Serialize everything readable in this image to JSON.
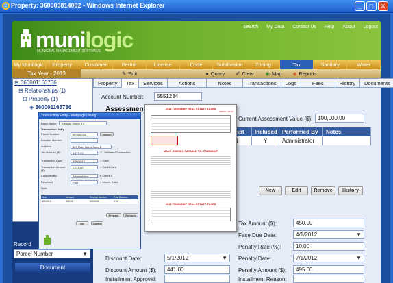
{
  "window": {
    "title": "Property: 360003814002 - Windows Internet Explorer"
  },
  "header": {
    "logo_main": "muni",
    "logo_accent": "logic",
    "logo_sub": "MUNICIPAL MANAGEMENT SOFTWARE",
    "links": [
      "Search",
      "My Data",
      "Contact Us",
      "Help",
      "About",
      "Logout"
    ]
  },
  "nav": [
    "My Munilogic",
    "Property",
    "Customer",
    "Permit",
    "License",
    "Code",
    "Subdivision",
    "Zoning",
    "Tax",
    "Sanitary",
    "Water"
  ],
  "subbar": {
    "title": "Tax Year - 2013",
    "items": [
      "Edit",
      "Query",
      "Clear",
      "Map",
      "Reports"
    ]
  },
  "tree": {
    "root": "360001163736",
    "relationships": "Relationships (1)",
    "property": "Property (1)",
    "child": "360001163736"
  },
  "tabs": [
    "Property",
    "Tax",
    "Services",
    "Actions",
    "Notes",
    "Transactions",
    "Logs",
    "Fees",
    "History",
    "Documents"
  ],
  "main": {
    "account_label": "Account Number:",
    "account_value": "5551234",
    "assessments_label": "Assessments",
    "current_assessment_label": "Current Assessment Value ($):",
    "current_assessment_value": "100,000.00",
    "table_headers": [
      "mpt",
      "Included",
      "Performed By",
      "Notes"
    ],
    "table_row": [
      "N",
      "Y",
      "Administrator",
      ""
    ],
    "buttons": [
      "New",
      "Edit",
      "Remove",
      "History"
    ],
    "tax_amount_label": "Tax Amount ($):",
    "tax_amount_value": "450.00",
    "face_due_label": "Face Due Date:",
    "face_due_value": "4/1/2012",
    "penalty_rate_label": "Penalty Rate (%):",
    "penalty_rate_value": "10.00",
    "penalty_date_label": "Penalty Date:",
    "penalty_date_value": "7/1/2012",
    "penalty_amount_label": "Penalty Amount ($):",
    "penalty_amount_value": "495.00",
    "discount_date_label": "Discount Date:",
    "discount_date_value": "5/1/2012",
    "discount_amount_label": "Discount Amount ($):",
    "discount_amount_value": "441.00",
    "installment_approval_label": "Installment Approval:",
    "installment_reason_label": "Installment Reason:"
  },
  "left": {
    "record_label": "Record",
    "parcel_select": "Parcel Number",
    "document_button": "Document"
  },
  "popup": {
    "title": "Transaction Entry - Webpage Dialog",
    "batch_label": "Batch Name:",
    "batch_value": "Tuesday, March 13",
    "section": "Transaction Entry",
    "fields": [
      {
        "label": "Parcel Number:",
        "value": "00 000 000"
      },
      {
        "label": "Location Number:",
        "value": ""
      },
      {
        "label": "Address:",
        "value": "123 Main Street Suite 1"
      },
      {
        "label": "Tax Balance ($):",
        "value": "1,275.00"
      },
      {
        "label": "Transaction Date:",
        "value": "3/30/2013"
      },
      {
        "label": "Transaction Amount ($):",
        "value": "1,275.00"
      },
      {
        "label": "Collected By:",
        "value": "Administrator"
      },
      {
        "label": "Received:",
        "value": "Paid"
      },
      {
        "label": "Note:",
        "value": ""
      }
    ],
    "radio_options": [
      "Cash",
      "Credit Card",
      "Check #",
      "Money Order"
    ],
    "search_button": "Search",
    "validated_label": "Validated Transaction",
    "table_headers": [
      "Date",
      "Amount",
      "Receipt Number",
      "Post Balance"
    ],
    "table_row": [
      "3/9/2013",
      "500.00",
      "0000001",
      "0.00"
    ],
    "buttons": [
      "Prepare",
      "Remove"
    ],
    "ok_button": "OK",
    "cancel_button": "Cancel"
  },
  "bill": {
    "title": "2013 TOWNSHIP REAL ESTATE TAXES",
    "mid_title": "MAKE CHECKS PAYABLE TO: TOWNSHIP",
    "bottom_title": "2013 TOWNSHIP REAL ESTATE TAXES",
    "bill_no": "000001 - 00711"
  }
}
